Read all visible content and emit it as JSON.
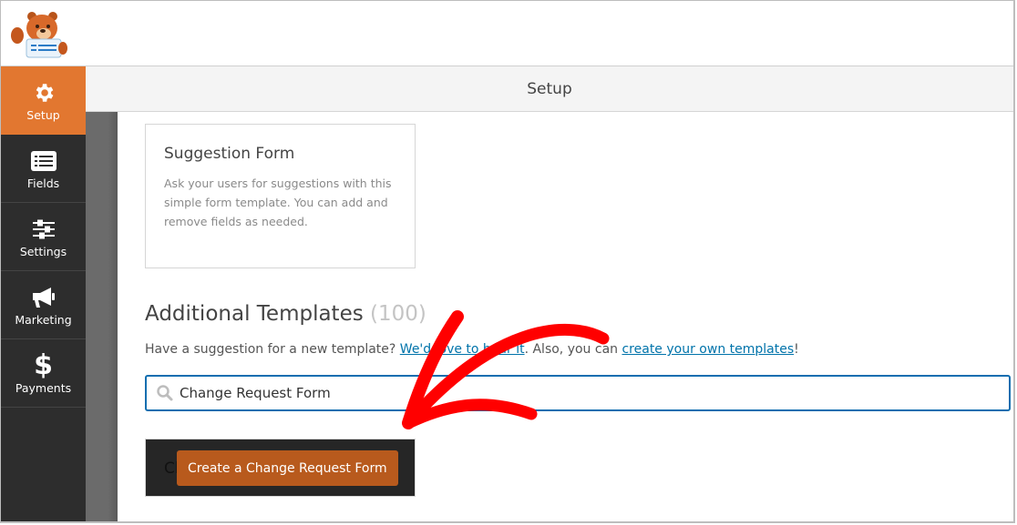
{
  "header": {
    "title": "Setup"
  },
  "sidebar": {
    "items": [
      {
        "label": "Setup",
        "icon": "gear-icon",
        "active": true
      },
      {
        "label": "Fields",
        "icon": "list-icon",
        "active": false
      },
      {
        "label": "Settings",
        "icon": "sliders-icon",
        "active": false
      },
      {
        "label": "Marketing",
        "icon": "megaphone-icon",
        "active": false
      },
      {
        "label": "Payments",
        "icon": "dollar-icon",
        "active": false
      }
    ]
  },
  "template_card": {
    "title": "Suggestion Form",
    "description": "Ask your users for suggestions with this simple form template. You can add and remove fields as needed."
  },
  "additional_templates": {
    "title": "Additional Templates",
    "count": "(100)",
    "desc_prefix": "Have a suggestion for a new template? ",
    "link1": "We'd love to hear it",
    "desc_middle": ". Also, you can ",
    "link2": "create your own templates",
    "desc_suffix": "!"
  },
  "search": {
    "value": "Change Request Form",
    "icon": "search-icon"
  },
  "result": {
    "behind_text": "Ch",
    "button_label": "Create a Change Request Form"
  },
  "colors": {
    "accent": "#e27730",
    "button": "#b85a1d",
    "sidebar": "#2d2d2d",
    "link": "#0073aa",
    "input_border": "#0e6eb0",
    "annotation_arrow": "#ff0000"
  }
}
